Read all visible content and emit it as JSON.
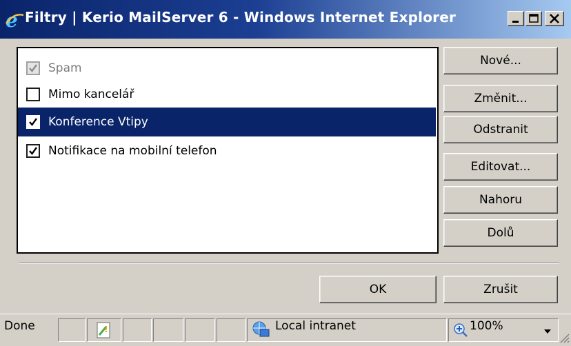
{
  "window": {
    "title": "Filtry | Kerio MailServer 6 - Windows Internet Explorer",
    "controls": [
      "minimize",
      "maximize",
      "close"
    ]
  },
  "filters": {
    "items": [
      {
        "label": "Spam",
        "checked": true,
        "disabled": true,
        "selected": false
      },
      {
        "label": "Mimo kancelář",
        "checked": false,
        "disabled": false,
        "selected": false
      },
      {
        "label": "Konference Vtipy",
        "checked": true,
        "disabled": false,
        "selected": true
      },
      {
        "label": "Notifikace na mobilní telefon",
        "checked": true,
        "disabled": false,
        "selected": false
      }
    ]
  },
  "actions": {
    "new": "Nové...",
    "change": "Změnit...",
    "remove": "Odstranit",
    "edit": "Editovat...",
    "up": "Nahoru",
    "down": "Dolů"
  },
  "dialog": {
    "ok": "OK",
    "cancel": "Zrušit"
  },
  "statusbar": {
    "status": "Done",
    "zone": "Local intranet",
    "zoom": "100%"
  },
  "colors": {
    "selection": "#0a246a",
    "face": "#d4d0c8"
  }
}
